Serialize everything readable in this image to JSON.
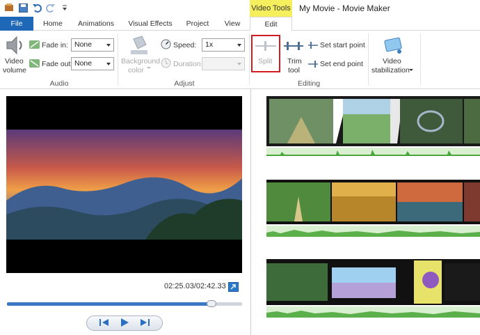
{
  "window": {
    "title": "My Movie - Movie Maker",
    "context_tab": "Video Tools"
  },
  "tabs": [
    {
      "label": "File"
    },
    {
      "label": "Home"
    },
    {
      "label": "Animations"
    },
    {
      "label": "Visual Effects"
    },
    {
      "label": "Project"
    },
    {
      "label": "View"
    },
    {
      "label": "Edit"
    }
  ],
  "ribbon": {
    "audio": {
      "group_label": "Audio",
      "video_volume_label_1": "Video",
      "video_volume_label_2": "volume",
      "fade_in_label": "Fade in:",
      "fade_in_value": "None",
      "fade_out_label": "Fade out:",
      "fade_out_value": "None"
    },
    "adjust": {
      "group_label": "Adjust",
      "bg_color_label_1": "Background",
      "bg_color_label_2": "color",
      "speed_label": "Speed:",
      "speed_value": "1x",
      "duration_label": "Duration:",
      "duration_value": ""
    },
    "editing": {
      "group_label": "Editing",
      "split_label": "Split",
      "trim_label_1": "Trim",
      "trim_label_2": "tool",
      "set_start_label": "Set start point",
      "set_end_label": "Set end point"
    },
    "stabilization": {
      "label_1": "Video",
      "label_2": "stabilization"
    }
  },
  "player": {
    "time": "02:25.03/02:42.33",
    "progress_fraction": 0.87
  },
  "colors": {
    "file_tab": "#1e68b7",
    "context_tab": "#f5ef5e",
    "highlight": "#d11b22",
    "seek_fill": "#3b78c4",
    "audio_wave": "#c5ebb8"
  },
  "icons": [
    "undo-icon",
    "redo-icon",
    "save-icon",
    "speaker-icon",
    "fade-in-icon",
    "fade-out-icon",
    "paint-bucket-icon",
    "speedometer-icon",
    "clock-icon",
    "split-icon",
    "trim-icon",
    "set-start-icon",
    "set-end-icon",
    "stabilization-icon",
    "fullscreen-icon",
    "prev-frame-icon",
    "play-icon",
    "next-frame-icon"
  ]
}
